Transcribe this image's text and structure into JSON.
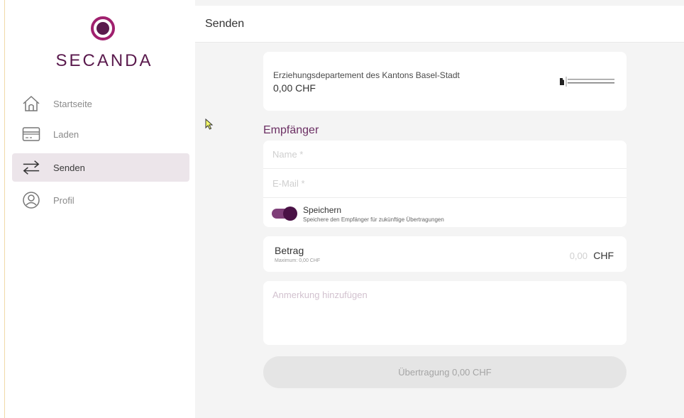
{
  "brand": {
    "name": "SECANDA",
    "accent_color": "#5a1a4d",
    "icon": "secanda-logo-icon"
  },
  "nav": {
    "items": [
      {
        "label": "Startseite",
        "icon": "home-icon",
        "active": false
      },
      {
        "label": "Laden",
        "icon": "card-icon",
        "active": false
      },
      {
        "label": "Senden",
        "icon": "transfer-arrows-icon",
        "active": true
      },
      {
        "label": "Profil",
        "icon": "user-circle-icon",
        "active": false
      }
    ]
  },
  "header": {
    "title": "Senden"
  },
  "account": {
    "name": "Erziehungsdepartement des Kantons Basel-Stadt",
    "balance": "0,00 CHF",
    "logo_icon": "basel-stadt-logo-icon"
  },
  "recipient": {
    "title": "Empfänger",
    "name_placeholder": "Name *",
    "name_value": "",
    "email_placeholder": "E-Mail *",
    "email_value": "",
    "save_label": "Speichern",
    "save_description": "Speichere den Empfänger für zukünftige Übertragungen",
    "save_enabled": true
  },
  "amount": {
    "label": "Betrag",
    "maximum": "Maximum: 0,00 CHF",
    "value_placeholder": "0,00",
    "currency": "CHF"
  },
  "note": {
    "placeholder": "Anmerkung hinzufügen",
    "value": ""
  },
  "submit": {
    "label": "Übertragung 0,00 CHF",
    "enabled": false
  }
}
